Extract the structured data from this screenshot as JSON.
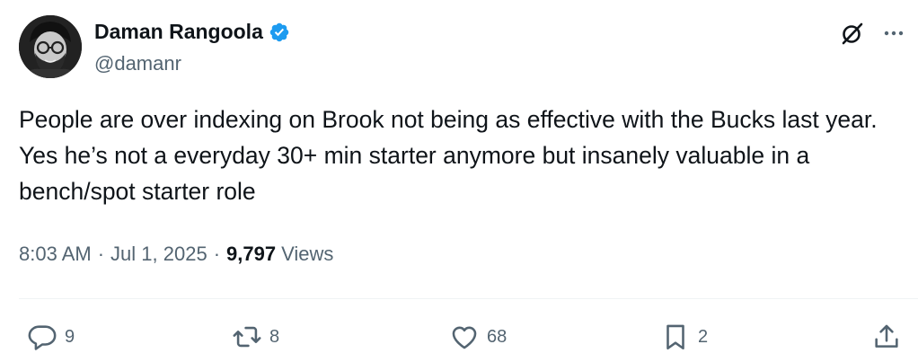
{
  "author": {
    "display_name": "Daman Rangoola",
    "handle": "@damanr",
    "verified": true
  },
  "tweet": {
    "text": "People are over indexing on Brook not being as effective with the Bucks last year. Yes he’s not a everyday 30+ min starter anymore but insanely valuable in a bench/spot starter role"
  },
  "meta": {
    "time": "8:03 AM",
    "separator": "·",
    "date": "Jul 1, 2025",
    "views_count": "9,797",
    "views_label": "Views"
  },
  "actions": {
    "replies": "9",
    "reposts": "8",
    "likes": "68",
    "bookmarks": "2"
  },
  "icons": {
    "verified": "verified-badge-icon",
    "grok": "grok-icon",
    "more": "more-icon",
    "reply": "reply-icon",
    "repost": "repost-icon",
    "like": "heart-icon",
    "bookmark": "bookmark-icon",
    "share": "share-icon"
  },
  "colors": {
    "text_primary": "#0f1419",
    "text_secondary": "#536471",
    "verified_blue": "#1d9bf0",
    "divider": "#eff3f4"
  }
}
